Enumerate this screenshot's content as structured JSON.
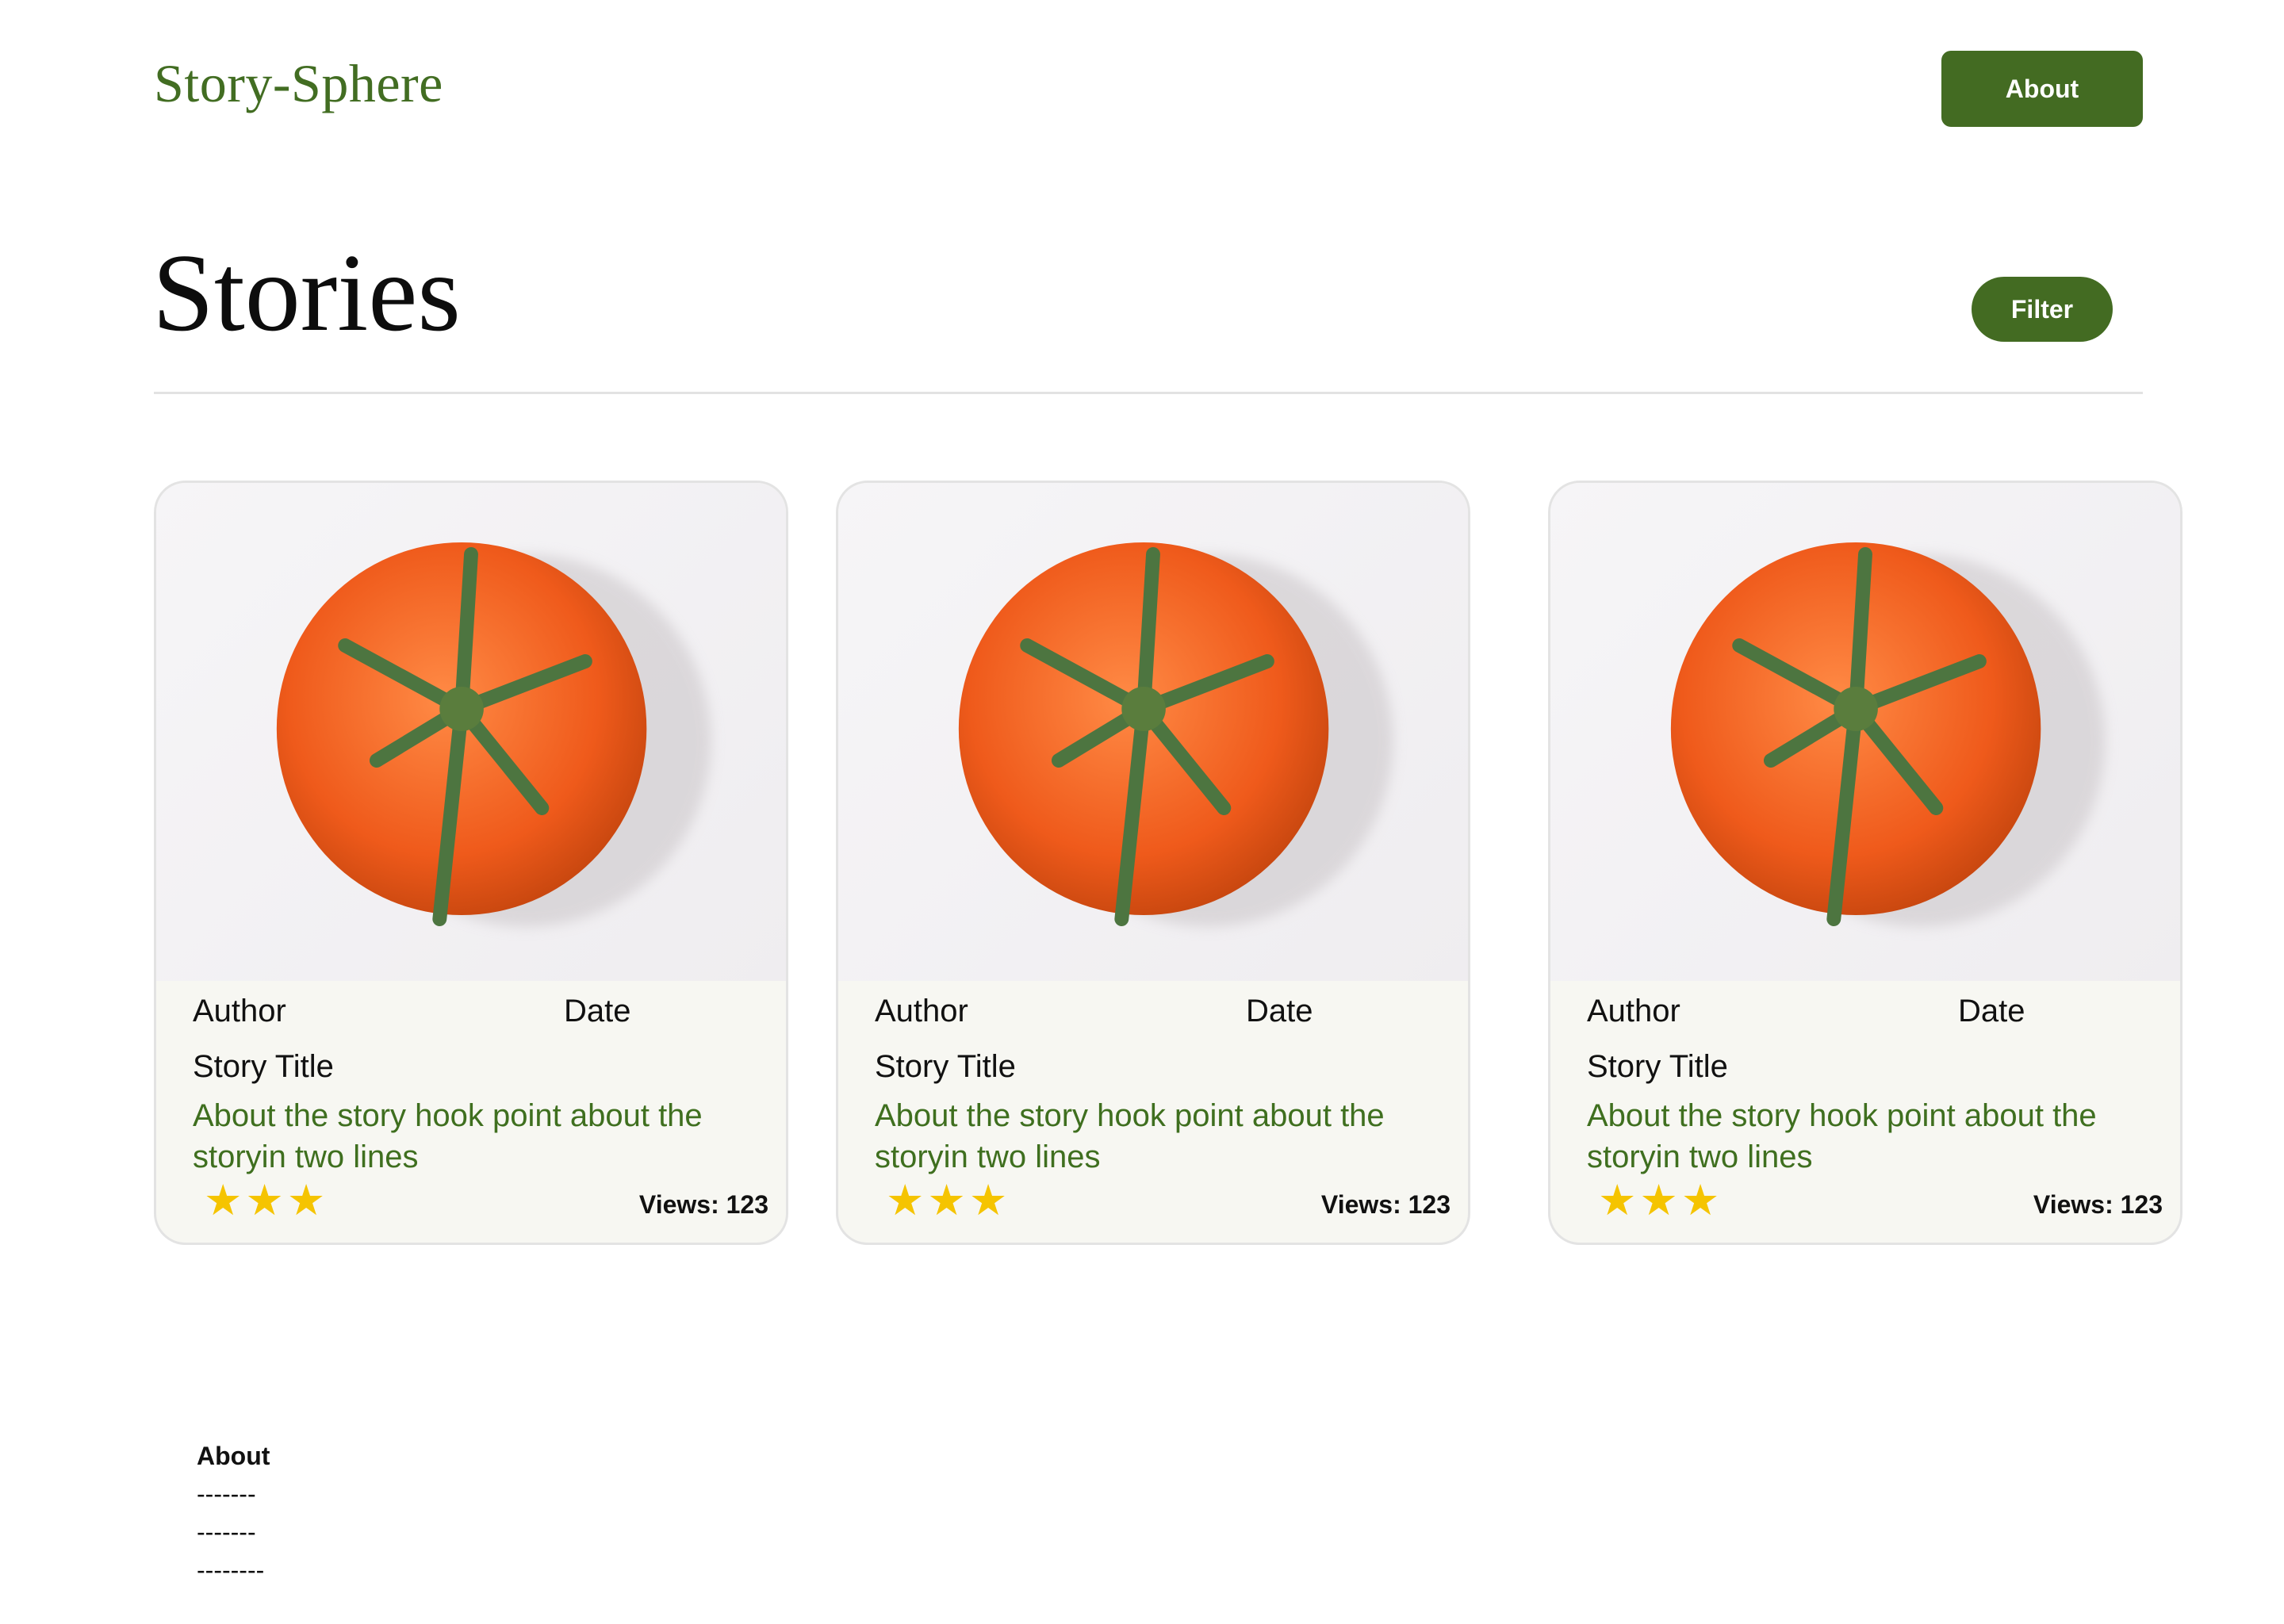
{
  "header": {
    "logo": "Story-Sphere",
    "about_label": "About"
  },
  "page": {
    "title": "Stories",
    "filter_label": "Filter"
  },
  "cards": [
    {
      "author": "Author",
      "date": "Date",
      "title": "Story Title",
      "hook": "About the story hook point about the storyin two lines",
      "rating": 3,
      "views": "Views: 123",
      "image": "tomato-photo"
    },
    {
      "author": "Author",
      "date": "Date",
      "title": "Story Title",
      "hook": "About the story hook point about the storyin two lines",
      "rating": 3,
      "views": "Views: 123",
      "image": "tomato-photo"
    },
    {
      "author": "Author",
      "date": "Date",
      "title": "Story Title",
      "hook": "About the story hook point about the storyin two lines",
      "rating": 3,
      "views": "Views: 123",
      "image": "tomato-photo"
    }
  ],
  "footer": {
    "title": "About",
    "lines": [
      "-------",
      "-------",
      "--------"
    ]
  },
  "colors": {
    "brand_green": "#436b22",
    "hook_green": "#3f6f1f",
    "star_yellow": "#f5c400"
  }
}
